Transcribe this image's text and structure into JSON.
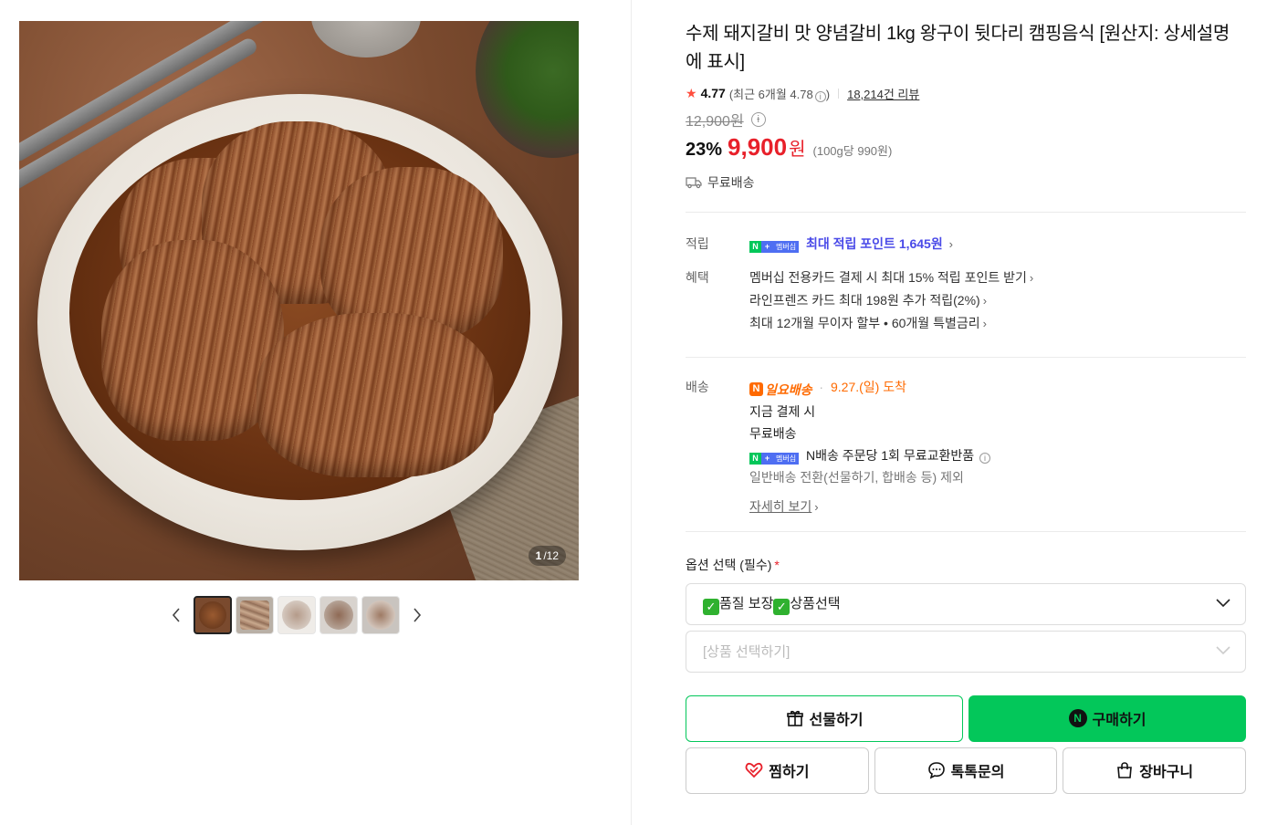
{
  "gallery": {
    "counter_current": "1",
    "counter_total": "/12",
    "thumbnails": [
      "thumb-1",
      "thumb-2",
      "thumb-3",
      "thumb-4",
      "thumb-5"
    ]
  },
  "product": {
    "title": "수제 돼지갈비 맛 양념갈비 1kg 왕구이 뒷다리 캠핑음식 [원산지: 상세설명에 표시]",
    "rating": "4.77",
    "recent_rating": "(최근 6개월 4.78",
    "recent_close": ")",
    "reviews": "18,214건 리뷰",
    "original_price": "12,900원",
    "discount": "23%",
    "price": "9,900",
    "currency": "원",
    "unit_price": "(100g당 990원)",
    "shipping": "무료배송"
  },
  "points": {
    "label": "적립",
    "badge_n": "N",
    "badge_plus": "+",
    "badge_membership": "멤버십",
    "text": "최대 적립 포인트 1,645원"
  },
  "benefits": {
    "label": "혜택",
    "items": [
      "멤버십 전용카드 결제 시 최대 15% 적립 포인트 받기",
      "라인프렌즈 카드 최대 198원 추가 적립(2%)",
      "최대 12개월 무이자 할부 • 60개월 특별금리"
    ]
  },
  "delivery": {
    "label": "배송",
    "badge": "일요배송",
    "badge_n": "N",
    "arrival": "9.27.(일) 도착",
    "line1": "지금 결제 시",
    "line2": "무료배송",
    "exchange": "N배송 주문당 1회 무료교환반품",
    "note": "일반배송 전환(선물하기, 합배송 등) 제외",
    "more": "자세히 보기"
  },
  "options": {
    "label": "옵션 선택 (필수)",
    "required_mark": "*",
    "select1_text1": "품질 보장",
    "select1_text2": "상품선택",
    "select2_placeholder": "[상품 선택하기]"
  },
  "actions": {
    "gift": "선물하기",
    "buy": "구매하기",
    "buy_badge": "N",
    "wish": "찜하기",
    "talk": "톡톡문의",
    "cart": "장바구니"
  },
  "colors": {
    "naver_green": "#03c75a",
    "price_red": "#e8202a",
    "delivery_orange": "#ff6a00",
    "point_blue": "#4a4ae8"
  }
}
